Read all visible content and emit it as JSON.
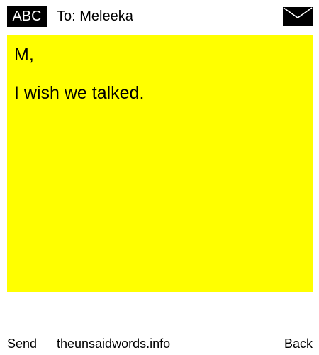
{
  "header": {
    "keyboard_label": "ABC",
    "to_text": "To: Meleeka",
    "mail_icon": "envelope-icon"
  },
  "note": {
    "background": "#ffff00",
    "greeting": "M,",
    "body": "I wish we talked."
  },
  "footer": {
    "send_label": "Send",
    "site_text": "theunsaidwords.info",
    "back_label": "Back"
  }
}
